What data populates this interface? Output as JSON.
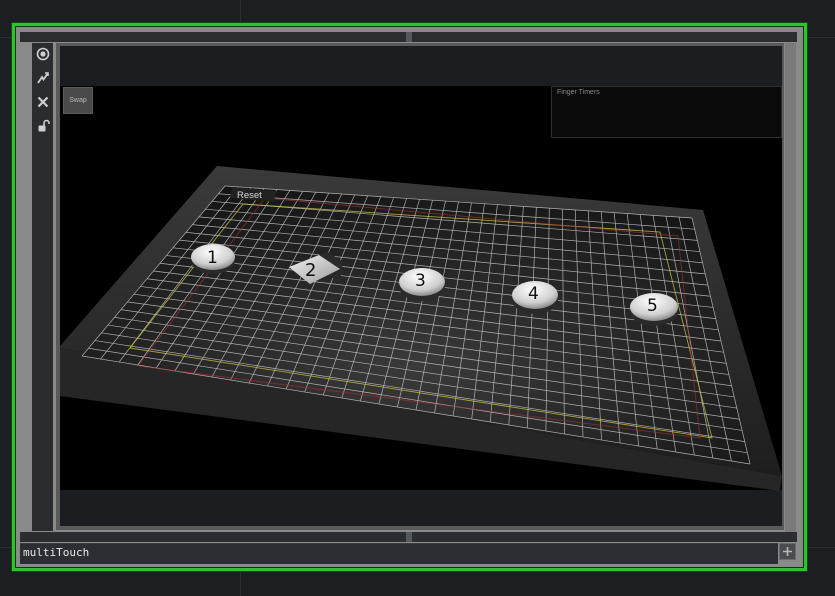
{
  "node": {
    "name": "multiTouch",
    "border_color": "#2fc22f"
  },
  "toolbar": {
    "buttons": [
      {
        "icon": "view-icon"
      },
      {
        "icon": "bypass-icon"
      },
      {
        "icon": "close-icon"
      },
      {
        "icon": "lock-icon"
      }
    ]
  },
  "viewer": {
    "swap_label": "Swap",
    "finger_timers_label": "Finger Timers",
    "reset_label": "Reset",
    "pucks": [
      {
        "label": "1",
        "shape": "round"
      },
      {
        "label": "2",
        "shape": "diamond"
      },
      {
        "label": "3",
        "shape": "round"
      },
      {
        "label": "4",
        "shape": "round"
      },
      {
        "label": "5",
        "shape": "round"
      }
    ]
  }
}
